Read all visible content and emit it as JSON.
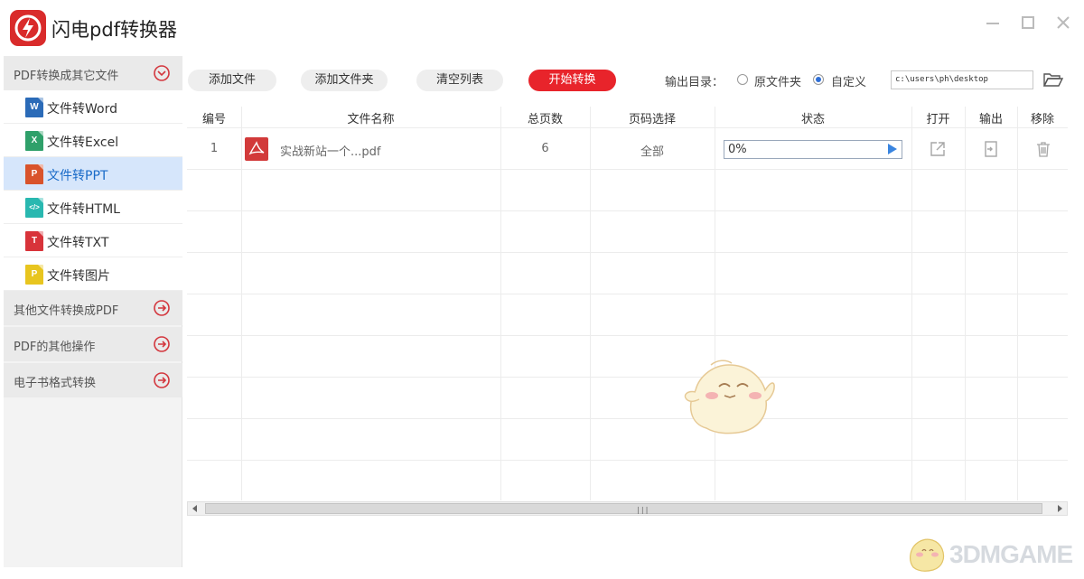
{
  "window": {
    "title": "闪电pdf转换器",
    "accent": "#e8242b"
  },
  "sidebar": {
    "groups": [
      {
        "label": "PDF转换成其它文件",
        "expanded": true,
        "items": [
          {
            "label": "文件转Word",
            "badge": "W",
            "color": "#2b6bb8"
          },
          {
            "label": "文件转Excel",
            "badge": "X",
            "color": "#2fa06a"
          },
          {
            "label": "文件转PPT",
            "badge": "P",
            "color": "#d9532b",
            "active": true
          },
          {
            "label": "文件转HTML",
            "badge": "</>",
            "color": "#29b8b0"
          },
          {
            "label": "文件转TXT",
            "badge": "T",
            "color": "#d8333a"
          },
          {
            "label": "文件转图片",
            "badge": "P",
            "color": "#e8c51f"
          }
        ]
      },
      {
        "label": "其他文件转换成PDF",
        "expanded": false
      },
      {
        "label": "PDF的其他操作",
        "expanded": false
      },
      {
        "label": "电子书格式转换",
        "expanded": false
      }
    ]
  },
  "toolbar": {
    "add_file": "添加文件",
    "add_folder": "添加文件夹",
    "clear_list": "清空列表",
    "start": "开始转换",
    "output_label": "输出目录：",
    "radio_original": "原文件夹",
    "radio_custom": "自定义",
    "selected_output": "自定义",
    "path_value": "c:\\users\\ph\\desktop"
  },
  "table": {
    "headers": [
      "编号",
      "文件名称",
      "总页数",
      "页码选择",
      "状态",
      "打开",
      "输出",
      "移除"
    ],
    "rows": [
      {
        "index": "1",
        "filename": "实战新站一个...pdf",
        "pages": "6",
        "page_select": "全部",
        "progress_text": "0%",
        "progress": 0
      }
    ]
  },
  "watermark": {
    "text": "3DMGAME"
  }
}
